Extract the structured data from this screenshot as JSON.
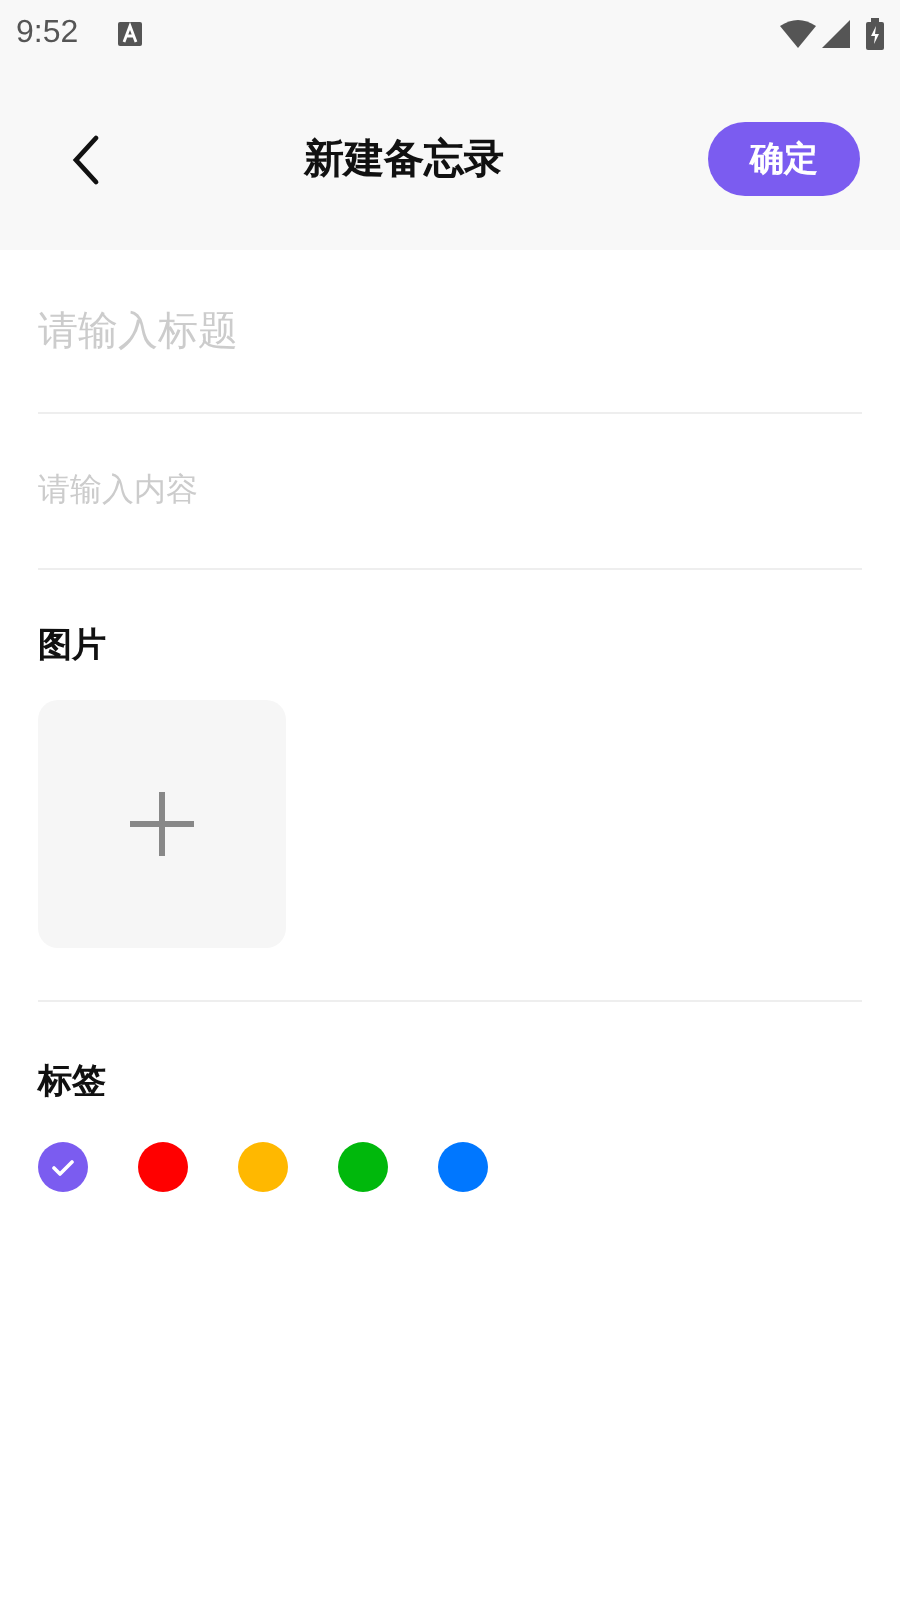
{
  "status_bar": {
    "time": "9:52"
  },
  "header": {
    "title": "新建备忘录",
    "confirm_button": "确定"
  },
  "title_field": {
    "placeholder": "请输入标题"
  },
  "content_field": {
    "placeholder": "请输入内容"
  },
  "images": {
    "label": "图片"
  },
  "tags": {
    "label": "标签",
    "colors": [
      {
        "color": "#7b5cf0",
        "selected": true
      },
      {
        "color": "#ff0000",
        "selected": false
      },
      {
        "color": "#ffb800",
        "selected": false
      },
      {
        "color": "#00b80c",
        "selected": false
      },
      {
        "color": "#0077ff",
        "selected": false
      }
    ]
  }
}
